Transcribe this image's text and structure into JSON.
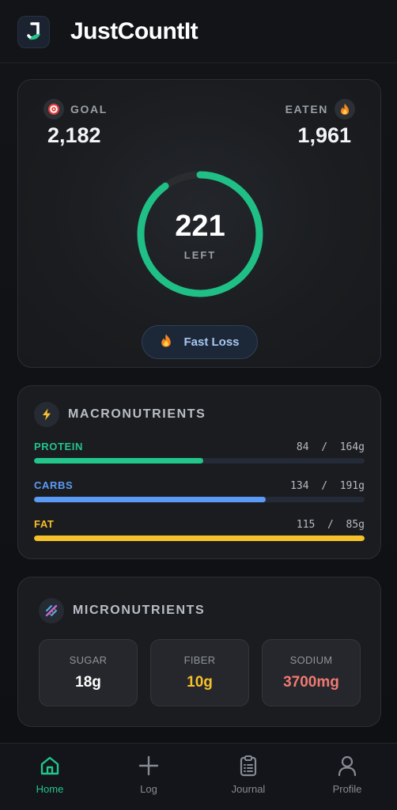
{
  "app": {
    "title": "JustCountIt"
  },
  "calories": {
    "goal_label": "GOAL",
    "goal_value": "2,182",
    "eaten_label": "EATEN",
    "eaten_value": "1,961",
    "left_value": "221",
    "left_label": "LEFT",
    "progress_fraction": 0.9,
    "ring_color": "#1fbf86",
    "goal_icon": "target-icon",
    "eaten_icon": "flame-icon"
  },
  "plan_button": {
    "label": "Fast Loss",
    "icon": "flame-icon"
  },
  "macros": {
    "title": "MACRONUTRIENTS",
    "icon": "lightning-icon",
    "items": [
      {
        "name": "PROTEIN",
        "current": 84,
        "target": 164,
        "display": "84  /  164g",
        "color": "#22c58a"
      },
      {
        "name": "CARBS",
        "current": 134,
        "target": 191,
        "display": "134  /  191g",
        "color": "#5b9bf5"
      },
      {
        "name": "FAT",
        "current": 115,
        "target": 85,
        "display": "115  /  85g",
        "color": "#f6c02a"
      }
    ]
  },
  "micros": {
    "title": "MICRONUTRIENTS",
    "icon": "dna-icon",
    "items": [
      {
        "label": "SUGAR",
        "value": "18g",
        "color": "#ffffff"
      },
      {
        "label": "FIBER",
        "value": "10g",
        "color": "#f6c02a"
      },
      {
        "label": "SODIUM",
        "value": "3700mg",
        "color": "#f07a72"
      }
    ]
  },
  "nav": {
    "items": [
      {
        "label": "Home",
        "icon": "home-icon",
        "active": true
      },
      {
        "label": "Log",
        "icon": "plus-icon",
        "active": false
      },
      {
        "label": "Journal",
        "icon": "clipboard-icon",
        "active": false
      },
      {
        "label": "Profile",
        "icon": "user-icon",
        "active": false
      }
    ]
  }
}
